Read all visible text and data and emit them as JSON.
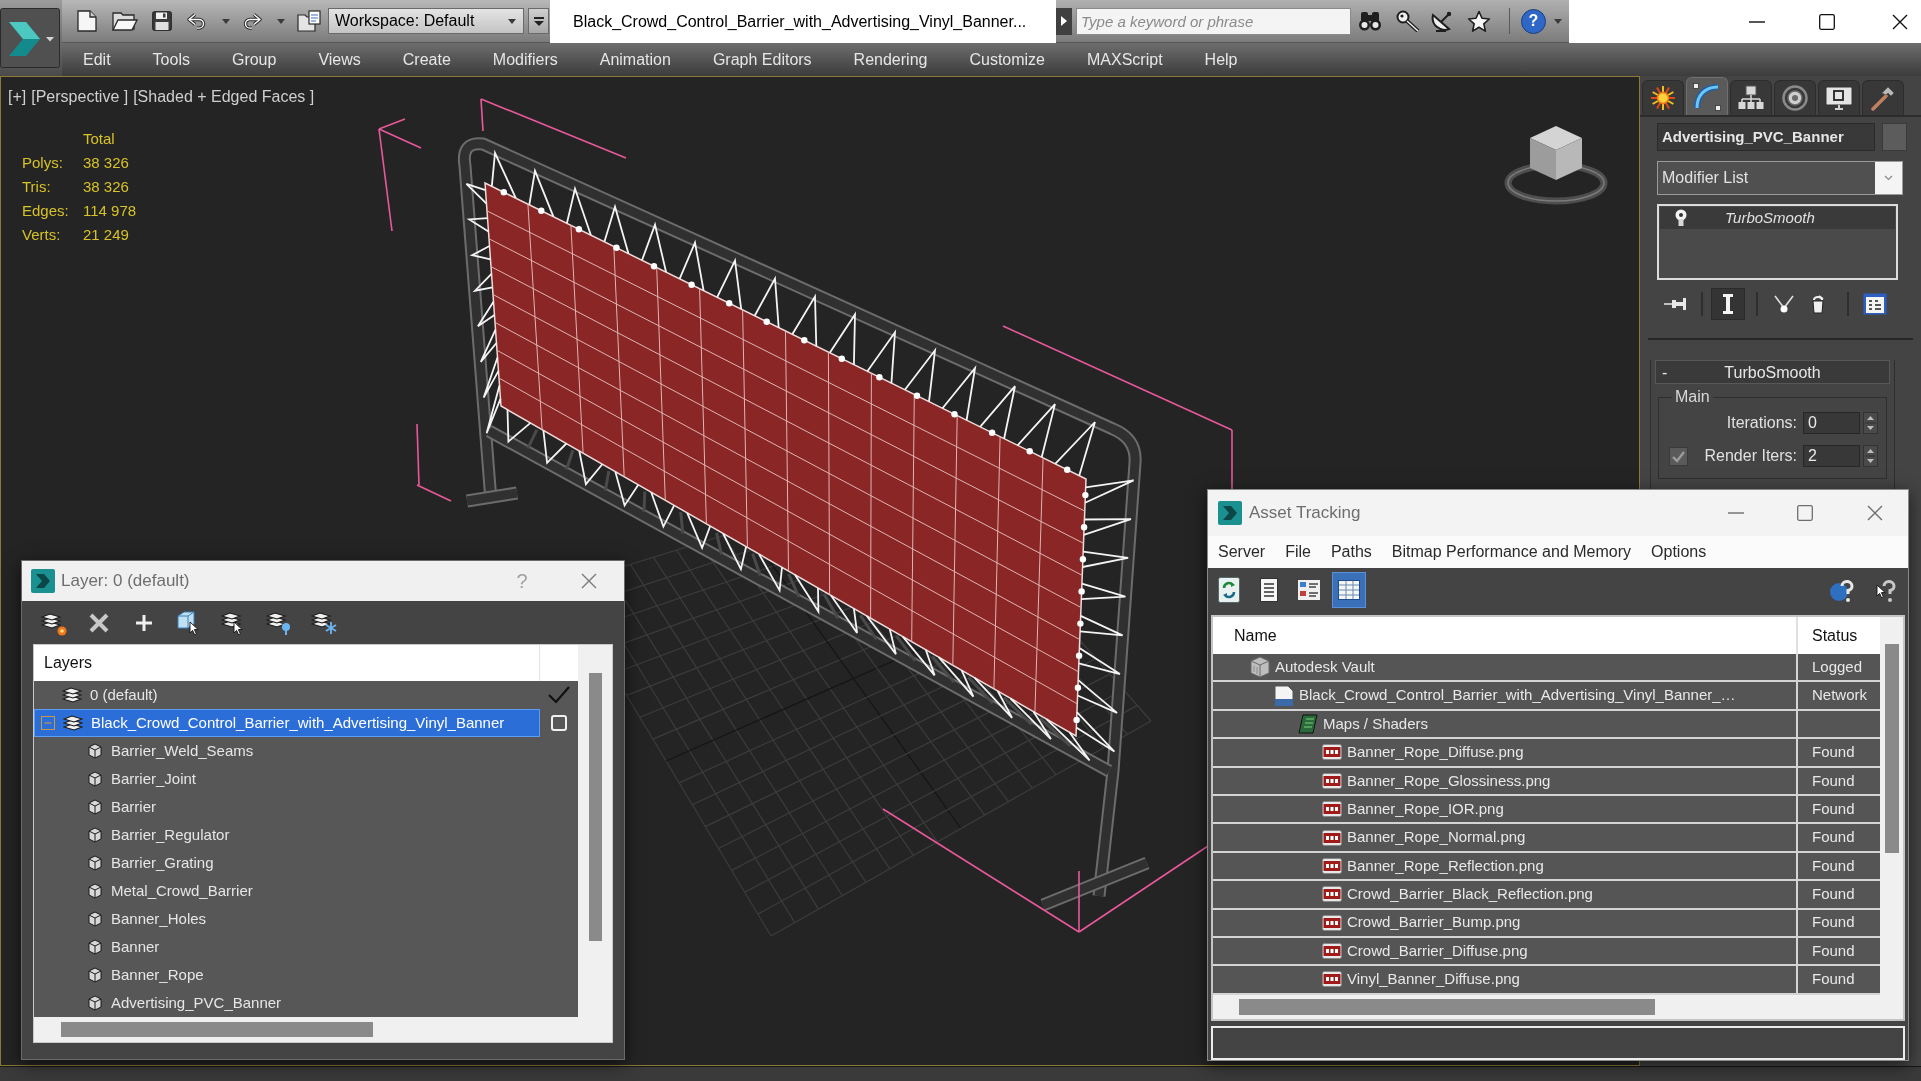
{
  "title_bar": {
    "workspace": "Workspace: Default",
    "document_title": "Black_Crowd_Control_Barrier_with_Advertising_Vinyl_Banner...",
    "search": {
      "placeholder": "Type a keyword or phrase"
    },
    "help": "?"
  },
  "menu_bar": [
    "Edit",
    "Tools",
    "Group",
    "Views",
    "Create",
    "Modifiers",
    "Animation",
    "Graph Editors",
    "Rendering",
    "Customize",
    "MAXScript",
    "Help"
  ],
  "viewport": {
    "labels": [
      "[+]",
      "[Perspective ]",
      "[Shaded + Edged Faces ]"
    ],
    "stats": {
      "header": "Total",
      "rows": [
        {
          "label": "Polys:",
          "value": "38 326"
        },
        {
          "label": "Tris:",
          "value": "38 326"
        },
        {
          "label": "Edges:",
          "value": "114 978"
        },
        {
          "label": "Verts:",
          "value": "21 249"
        }
      ]
    }
  },
  "command_panel": {
    "tabs": [
      {
        "kind": "create",
        "selected": false
      },
      {
        "kind": "modify",
        "selected": true
      },
      {
        "kind": "hierarchy",
        "selected": false
      },
      {
        "kind": "motion",
        "selected": false
      },
      {
        "kind": "display",
        "selected": false
      },
      {
        "kind": "utilities",
        "selected": false
      }
    ],
    "object_name": "Advertising_PVC_Banner",
    "modifier_list": "Modifier List",
    "stack": [
      {
        "label": "TurboSmooth"
      }
    ],
    "stack_tools": [
      {
        "kind": "pin",
        "selected": false
      },
      {
        "kind": "end_result",
        "selected": true
      },
      {
        "kind": "make_unique",
        "selected": false
      },
      {
        "kind": "remove",
        "selected": false
      },
      {
        "kind": "configure",
        "selected": false
      }
    ],
    "rollout": {
      "collapse": "-",
      "title": "TurboSmooth",
      "group": "Main",
      "fields": [
        {
          "kind": "spinner",
          "label": "Iterations:",
          "value": "0"
        },
        {
          "kind": "toggle_spinner",
          "label": "Render Iters:",
          "value": "2",
          "checked": true
        }
      ]
    }
  },
  "layer_dialog": {
    "title": "Layer: 0 (default)",
    "help": "?",
    "header": "Layers",
    "layers": [
      {
        "label": "0 (default)",
        "current": true,
        "selected": false
      },
      {
        "label": "Black_Crowd_Control_Barrier_with_Advertising_Vinyl_Banner",
        "current": false,
        "selected": true,
        "expanded": true,
        "children": [
          {
            "label": "Barrier_Weld_Seams",
            "selected": false
          },
          {
            "label": "Barrier_Joint",
            "selected": false
          },
          {
            "label": "Barrier",
            "selected": false
          },
          {
            "label": "Barrier_Regulator",
            "selected": false
          },
          {
            "label": "Barrier_Grating",
            "selected": false
          },
          {
            "label": "Metal_Crowd_Barrier",
            "selected": false
          },
          {
            "label": "Banner_Holes",
            "selected": false
          },
          {
            "label": "Banner",
            "selected": false
          },
          {
            "label": "Banner_Rope",
            "selected": false
          },
          {
            "label": "Advertising_PVC_Banner",
            "selected": false
          }
        ]
      }
    ]
  },
  "asset_tracking": {
    "title": "Asset Tracking",
    "menu": [
      "Server",
      "File",
      "Paths",
      "Bitmap Performance and Memory",
      "Options"
    ],
    "toolbar": [
      {
        "kind": "refresh",
        "selected": false
      },
      {
        "kind": "list",
        "selected": false
      },
      {
        "kind": "thumbnails",
        "selected": false
      },
      {
        "kind": "table",
        "selected": true
      }
    ],
    "columns": [
      "Name",
      "Status"
    ],
    "rows": [
      {
        "kind": "vault",
        "name": "Autodesk Vault",
        "status": "Logged",
        "selected": false,
        "children": [
          {
            "kind": "scene",
            "name": "Black_Crowd_Control_Barrier_with_Advertising_Vinyl_Banner_…",
            "status": "Network",
            "selected": false,
            "children": [
              {
                "kind": "maps",
                "name": "Maps / Shaders",
                "selected": false,
                "children": [
                  {
                    "kind": "image",
                    "name": "Banner_Rope_Diffuse.png",
                    "status": "Found",
                    "selected": false
                  },
                  {
                    "kind": "image",
                    "name": "Banner_Rope_Glossiness.png",
                    "status": "Found",
                    "selected": false
                  },
                  {
                    "kind": "image",
                    "name": "Banner_Rope_IOR.png",
                    "status": "Found",
                    "selected": false
                  },
                  {
                    "kind": "image",
                    "name": "Banner_Rope_Normal.png",
                    "status": "Found",
                    "selected": false
                  },
                  {
                    "kind": "image",
                    "name": "Banner_Rope_Reflection.png",
                    "status": "Found",
                    "selected": false
                  },
                  {
                    "kind": "image",
                    "name": "Crowd_Barrier_Black_Reflection.png",
                    "status": "Found",
                    "selected": false
                  },
                  {
                    "kind": "image",
                    "name": "Crowd_Barrier_Bump.png",
                    "status": "Found",
                    "selected": false
                  },
                  {
                    "kind": "image",
                    "name": "Crowd_Barrier_Diffuse.png",
                    "status": "Found",
                    "selected": false
                  },
                  {
                    "kind": "image",
                    "name": "Vinyl_Banner_Diffuse.png",
                    "status": "Found",
                    "selected": false
                  }
                ]
              }
            ]
          }
        ]
      }
    ]
  }
}
